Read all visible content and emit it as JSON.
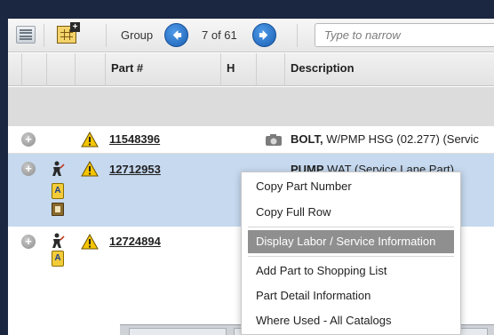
{
  "toolbar": {
    "group_label": "Group",
    "record_count": "7 of 61",
    "narrow_placeholder": "Type to narrow",
    "icons": [
      "list-icon",
      "grid-edit-icon",
      "prev-arrow-icon",
      "next-arrow-icon"
    ]
  },
  "table": {
    "headers": [
      "Part #",
      "H",
      "Description"
    ],
    "rows": [
      {
        "part": "11548396",
        "desc_bold": "BOLT,",
        "desc_rest": " W/PMP HSG (02.277) (Servic",
        "icons": [
          "expand-icon",
          "warning-icon",
          "camera-icon"
        ]
      },
      {
        "part": "12712953",
        "desc_bold": "PUMP",
        "desc_rest": " WAT (Service Lane Part)",
        "icons": [
          "expand-icon",
          "technician-icon",
          "key-icon",
          "book-icon",
          "warning-icon"
        ]
      },
      {
        "part": "12724894",
        "desc_bold": "",
        "desc_rest": "",
        "icons": [
          "expand-icon",
          "technician-icon",
          "key-icon",
          "warning-icon"
        ]
      }
    ]
  },
  "context_menu": {
    "items": [
      "Copy Part Number",
      "Copy Full Row",
      "Display Labor / Service Information",
      "Add Part to Shopping List",
      "Part Detail Information",
      "Where Used - All Catalogs"
    ],
    "highlighted": "Display Labor / Service Information"
  },
  "colors": {
    "selected_row": "#c6d9ef",
    "menu_highlight": "#8f8f8f",
    "nav_blue": "#1a5fb4",
    "warning_yellow": "#f5c400",
    "background": "#1b2640"
  }
}
